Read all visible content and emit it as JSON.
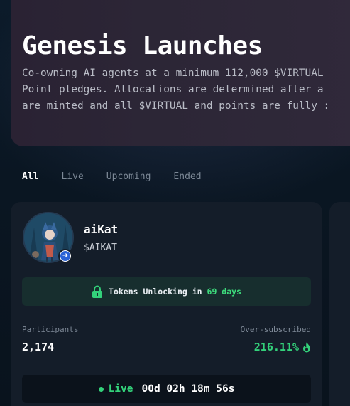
{
  "hero": {
    "title": "Genesis Launches",
    "description": "Co-owning AI agents at a minimum 112,000 $VIRTUAL\nPoint pledges. Allocations are determined after a\nare minted and all $VIRTUAL and points are fully :"
  },
  "tabs": [
    {
      "label": "All",
      "active": true
    },
    {
      "label": "Live",
      "active": false
    },
    {
      "label": "Upcoming",
      "active": false
    },
    {
      "label": "Ended",
      "active": false
    }
  ],
  "card": {
    "name": "aiKat",
    "ticker": "$AIKAT",
    "unlock_prefix": "Tokens Unlocking in",
    "unlock_days": "69 days",
    "participants_label": "Participants",
    "participants_value": "2,174",
    "oversub_label": "Over-subscribed",
    "oversub_value": "216.11%",
    "status": "Live",
    "countdown": "00d 02h 18m 56s"
  },
  "colors": {
    "accent_green": "#33d17a",
    "card_bg": "#141d29",
    "unlock_bg": "#172e2e"
  },
  "icons": {
    "lock": "lock-icon",
    "fire": "fire-icon",
    "badge": "arrow-badge-icon"
  }
}
